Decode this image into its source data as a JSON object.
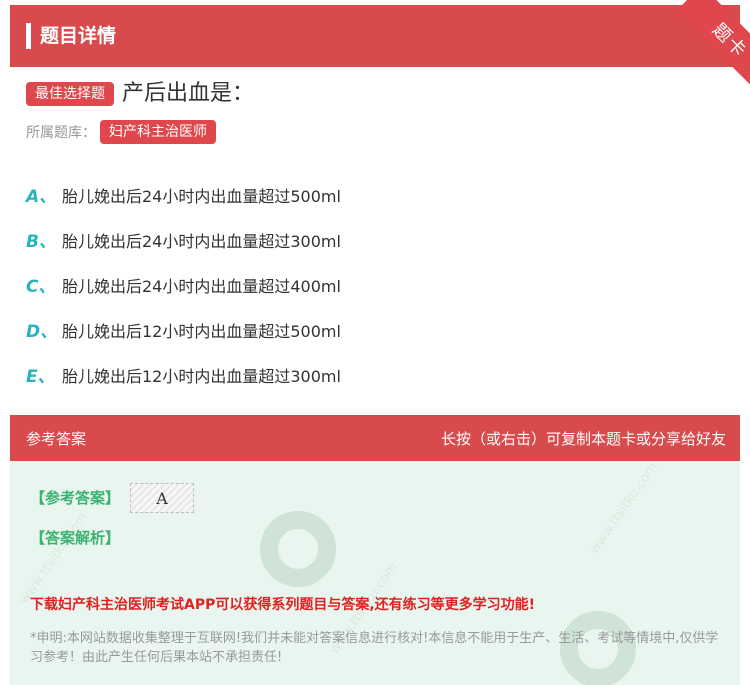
{
  "header": {
    "title": "题目详情"
  },
  "corner": {
    "label": "题卡"
  },
  "question": {
    "type_badge": "最佳选择题",
    "text": "产后出血是："
  },
  "category": {
    "label": "所属题库：",
    "name": "妇产科主治医师"
  },
  "options": [
    {
      "letter": "A、",
      "text": "胎儿娩出后24小时内出血量超过500ml"
    },
    {
      "letter": "B、",
      "text": "胎儿娩出后24小时内出血量超过300ml"
    },
    {
      "letter": "C、",
      "text": "胎儿娩出后24小时内出血量超过400ml"
    },
    {
      "letter": "D、",
      "text": "胎儿娩出后12小时内出血量超过500ml"
    },
    {
      "letter": "E、",
      "text": "胎儿娩出后12小时内出血量超过300ml"
    }
  ],
  "answer_section": {
    "title": "参考答案",
    "hint": "长按（或右击）可复制本题卡或分享给好友",
    "ref_label": "【参考答案】",
    "ref_value": "A",
    "explain_label": "【答案解析】",
    "promo": "下载妇产科主治医师考试APP可以获得系列题目与答案,还有练习等更多学习功能!",
    "disclaimer": "*申明:本网站数据收集整理于互联网!我们并未能对答案信息进行核对!本信息不能用于生产、生活、考试等情境中,仅供学习参考！由此产生任何后果本站不承担责任!"
  },
  "colors": {
    "accent_red": "#d94a4c",
    "option_teal": "#2ab3bd",
    "answer_green": "#3cb371",
    "answer_bg": "#e9f6ef",
    "promo_red": "#e0211f"
  }
}
